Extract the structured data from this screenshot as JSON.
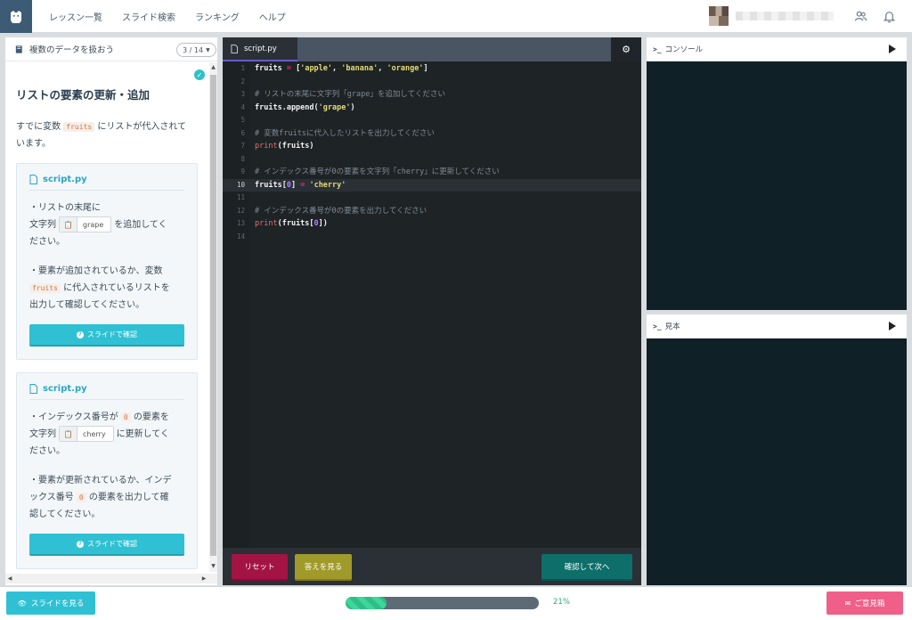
{
  "header": {
    "nav": [
      "レッスン一覧",
      "スライド検索",
      "ランキング",
      "ヘルプ"
    ]
  },
  "sidebar": {
    "lesson_title": "複数のデータを扱おう",
    "pager": "3 / 14",
    "exercise_title": "リストの要素の更新・追加",
    "intro_prefix": "すでに変数",
    "intro_code": "fruits",
    "intro_suffix": "にリストが代入されて",
    "intro_line2": "います。",
    "cards": [
      {
        "filename": "script.py",
        "line1": "・リストの末尾に",
        "line2_prefix": "文字列",
        "copy_value": "grape",
        "line2_suffix": "を追加してく",
        "line3": "ださい。",
        "line4": "・要素が追加されているか、変数",
        "line5_code": "fruits",
        "line5_suffix": "に代入されているリストを",
        "line6": "出力して確認してください。",
        "button": "スライドで確認"
      },
      {
        "filename": "script.py",
        "line1_prefix": "・インデックス番号が",
        "line1_code": "0",
        "line1_suffix": "の要素を",
        "line2_prefix": "文字列",
        "copy_value": "cherry",
        "line2_suffix": "に更新してく",
        "line3": "ださい。",
        "line4": "・要素が更新されているか、インデ",
        "line5_prefix": "ックス番号",
        "line5_code": "0",
        "line5_suffix": "の要素を出力して確",
        "line6": "認してください。",
        "button": "スライドで確認"
      }
    ]
  },
  "editor": {
    "tab": "script.py",
    "lines": [
      {
        "n": "1",
        "parts": [
          [
            "t",
            "fruits "
          ],
          [
            "o",
            "="
          ],
          [
            "t",
            " ["
          ],
          [
            "s",
            "'apple'"
          ],
          [
            "t",
            ", "
          ],
          [
            "s",
            "'banana'"
          ],
          [
            "t",
            ", "
          ],
          [
            "s",
            "'orange'"
          ],
          [
            "t",
            "]"
          ]
        ]
      },
      {
        "n": "2",
        "parts": []
      },
      {
        "n": "3",
        "parts": [
          [
            "c",
            "# リストの末尾に文字列「grape」を追加してください"
          ]
        ]
      },
      {
        "n": "4",
        "parts": [
          [
            "t",
            "fruits.append("
          ],
          [
            "s",
            "'grape'"
          ],
          [
            "t",
            ")"
          ]
        ]
      },
      {
        "n": "5",
        "parts": []
      },
      {
        "n": "6",
        "parts": [
          [
            "c",
            "# 変数fruitsに代入したリストを出力してください"
          ]
        ]
      },
      {
        "n": "7",
        "parts": [
          [
            "f",
            "print"
          ],
          [
            "t",
            "(fruits)"
          ]
        ]
      },
      {
        "n": "8",
        "parts": []
      },
      {
        "n": "9",
        "parts": [
          [
            "c",
            "# インデックス番号が0の要素を文字列「cherry」に更新してください"
          ]
        ]
      },
      {
        "n": "10",
        "parts": [
          [
            "t",
            "fruits["
          ],
          [
            "n",
            "0"
          ],
          [
            "t",
            "] "
          ],
          [
            "o",
            "="
          ],
          [
            "t",
            " "
          ],
          [
            "s",
            "'cherry'"
          ]
        ]
      },
      {
        "n": "11",
        "parts": []
      },
      {
        "n": "12",
        "parts": [
          [
            "c",
            "# インデックス番号が0の要素を出力してください"
          ]
        ]
      },
      {
        "n": "13",
        "parts": [
          [
            "f",
            "print"
          ],
          [
            "t",
            "(fruits["
          ],
          [
            "n",
            "0"
          ],
          [
            "t",
            "])"
          ]
        ]
      },
      {
        "n": "14",
        "parts": []
      }
    ],
    "active_line": 10,
    "reset_label": "リセット",
    "answer_label": "答えを見る",
    "next_label": "確認して次へ"
  },
  "console": {
    "prompt": ">_",
    "title": "コンソール"
  },
  "sample": {
    "prompt": ">_",
    "title": "見本"
  },
  "footer": {
    "slides_label": "スライドを見る",
    "progress": 0.21,
    "progress_text": "21%",
    "feedback_label": "ご意見箱"
  },
  "colors": {
    "accent": "#2fc1d3",
    "reset": "#a31445",
    "answer": "#a09a2a",
    "next": "#0e6f6a",
    "feedback": "#ef5f88"
  }
}
